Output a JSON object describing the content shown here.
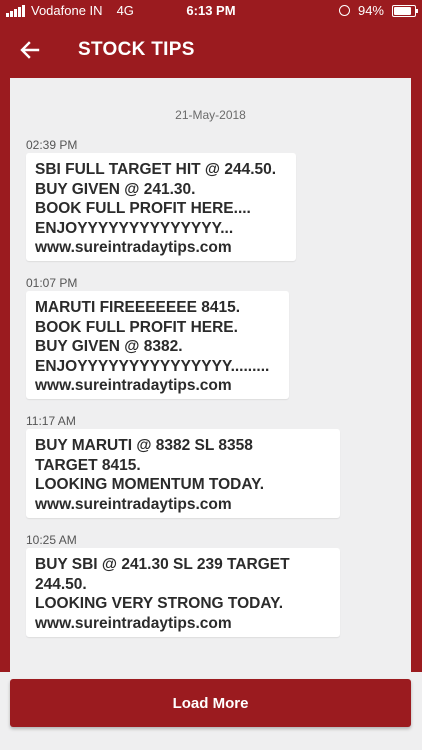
{
  "status_bar": {
    "carrier": "Vodafone IN",
    "network": "4G",
    "time": "6:13 PM",
    "battery": "94%",
    "battery_level": 0.94
  },
  "app_bar": {
    "title": "STOCK TIPS",
    "back_icon": "arrow-left-icon"
  },
  "feed": {
    "date": "21-May-2018",
    "messages": [
      {
        "time": "02:39 PM",
        "lines": [
          "SBI FULL TARGET HIT @ 244.50.",
          "BUY GIVEN @ 241.30.",
          "BOOK FULL PROFIT HERE....",
          "ENJOYYYYYYYYYYYYYY...",
          "www.sureintradaytips.com"
        ]
      },
      {
        "time": "01:07 PM",
        "lines": [
          "MARUTI FIREEEEEEE 8415.",
          "BOOK FULL PROFIT HERE.",
          "BUY GIVEN @ 8382.",
          "ENJOYYYYYYYYYYYYYYY.........",
          "www.sureintradaytips.com"
        ]
      },
      {
        "time": "11:17 AM",
        "lines": [
          "BUY MARUTI @ 8382 SL 8358",
          "TARGET 8415.",
          "LOOKING MOMENTUM TODAY.",
          "www.sureintradaytips.com"
        ]
      },
      {
        "time": "10:25 AM",
        "lines": [
          "BUY SBI @ 241.30 SL 239 TARGET",
          "244.50.",
          "LOOKING VERY STRONG TODAY.",
          "www.sureintradaytips.com"
        ]
      }
    ]
  },
  "load_more": {
    "label": "Load More"
  },
  "colors": {
    "brand": "#9b1b1f",
    "background": "#efeff0",
    "bubble": "#ffffff",
    "text": "#2b2b2b"
  }
}
